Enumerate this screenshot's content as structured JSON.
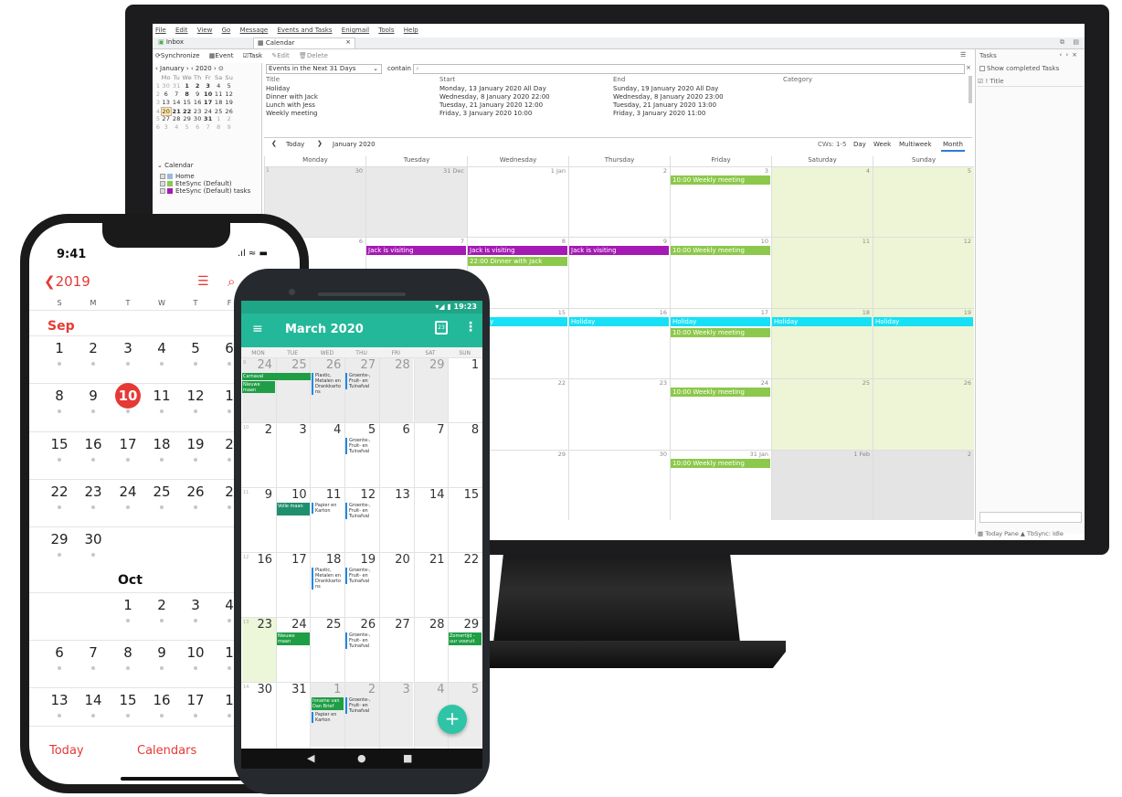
{
  "desktop": {
    "menu": [
      "File",
      "Edit",
      "View",
      "Go",
      "Message",
      "Events and Tasks",
      "Enigmail",
      "Tools",
      "Help"
    ],
    "tabs": {
      "inbox": "Inbox",
      "calendar": "Calendar",
      "close": "×"
    },
    "toolbar": {
      "synchronize": "Synchronize",
      "event": "Event",
      "task": "Task",
      "edit": "Edit",
      "delete": "Delete"
    },
    "minimonth": {
      "month": "January",
      "year": "2020",
      "weekdays": [
        "Mo",
        "Tu",
        "We",
        "Th",
        "Fr",
        "Sa",
        "Su"
      ],
      "weeks": [
        [
          "1",
          "30",
          "31",
          "1",
          "2",
          "3",
          "4",
          "5"
        ],
        [
          "2",
          "6",
          "7",
          "8",
          "9",
          "10",
          "11",
          "12"
        ],
        [
          "3",
          "13",
          "14",
          "15",
          "16",
          "17",
          "18",
          "19"
        ],
        [
          "4",
          "20",
          "21",
          "22",
          "23",
          "24",
          "25",
          "26"
        ],
        [
          "5",
          "27",
          "28",
          "29",
          "30",
          "31",
          "1",
          "2"
        ],
        [
          "6",
          "3",
          "4",
          "5",
          "6",
          "7",
          "8",
          "9"
        ]
      ]
    },
    "calendar_list": {
      "title": "Calendar",
      "items": [
        "Home",
        "EteSync (Default)",
        "EteSync (Default) tasks"
      ]
    },
    "filter": {
      "range": "Events in the Next 31 Days",
      "contain": "contain"
    },
    "event_list": {
      "headers": {
        "title": "Title",
        "start": "Start",
        "end": "End",
        "category": "Category"
      },
      "rows": [
        {
          "title": "Holiday",
          "start": "Monday, 13 January 2020 All Day",
          "end": "Sunday, 19 January 2020 All Day"
        },
        {
          "title": "Dinner with Jack",
          "start": "Wednesday, 8 January 2020 22:00",
          "end": "Wednesday, 8 January 2020 23:00"
        },
        {
          "title": "Lunch with Jess",
          "start": "Tuesday, 21 January 2020 12:00",
          "end": "Tuesday, 21 January 2020 13:00"
        },
        {
          "title": "Weekly meeting",
          "start": "Friday, 3 January 2020 10:00",
          "end": "Friday, 3 January 2020 11:00"
        }
      ]
    },
    "nav": {
      "today": "Today",
      "period": "January 2020",
      "cws": "CWs: 1-5",
      "views": [
        "Day",
        "Week",
        "Multiweek",
        "Month"
      ]
    },
    "weekdays": [
      "Monday",
      "Tuesday",
      "Wednesday",
      "Thursday",
      "Friday",
      "Saturday",
      "Sunday"
    ],
    "grid": {
      "row1": {
        "wk": "1",
        "days": [
          "30",
          "31 Dec",
          "1 Jan",
          "2",
          "3",
          "4",
          "5"
        ]
      },
      "row2": {
        "wk": "",
        "days": [
          "6",
          "7",
          "8",
          "9",
          "10",
          "11",
          "12"
        ]
      },
      "row3": {
        "days": [
          "15",
          "16",
          "17",
          "18",
          "19"
        ]
      },
      "row4": {
        "days": [
          "22",
          "23",
          "24",
          "25",
          "26"
        ]
      },
      "row5": {
        "days": [
          "29",
          "30",
          "31 Jan",
          "1 Feb",
          "2"
        ]
      }
    },
    "events": {
      "weekly": "10:00 Weekly meeting",
      "jack": "Jack is visiting",
      "dinner": "22:00 Dinner with Jack",
      "holiday": "Holiday"
    },
    "tasks": {
      "title": "Tasks",
      "show_completed": "Show completed Tasks",
      "col_title": "Title"
    },
    "status": {
      "today_pane": "Today Pane ▲",
      "sync": "TbSync: Idle"
    }
  },
  "iphone": {
    "time": "9:41",
    "back": "2019",
    "weekdays": [
      "S",
      "M",
      "T",
      "W",
      "T",
      "F"
    ],
    "month1": "Sep",
    "month2": "Oct",
    "rows": [
      [
        "1",
        "2",
        "3",
        "4",
        "5",
        "6"
      ],
      [
        "8",
        "9",
        "10",
        "11",
        "12",
        "1"
      ],
      [
        "15",
        "16",
        "17",
        "18",
        "19",
        "2"
      ],
      [
        "22",
        "23",
        "24",
        "25",
        "26",
        "2"
      ],
      [
        "29",
        "30"
      ],
      [
        "",
        "",
        "1",
        "2",
        "3",
        "4"
      ],
      [
        "6",
        "7",
        "8",
        "9",
        "10",
        "1"
      ],
      [
        "13",
        "14",
        "15",
        "16",
        "17",
        "1"
      ]
    ],
    "today_label": "Today",
    "calendars_label": "Calendars"
  },
  "android": {
    "time": "19:23",
    "title": "March 2020",
    "date_icon": "23",
    "weekdays": [
      "MON",
      "TUE",
      "WED",
      "THU",
      "FRI",
      "SAT",
      "SUN"
    ],
    "weeks": [
      {
        "wk": "9",
        "days": [
          "24",
          "25",
          "26",
          "27",
          "28",
          "29",
          "1"
        ]
      },
      {
        "wk": "10",
        "days": [
          "2",
          "3",
          "4",
          "5",
          "6",
          "7",
          "8"
        ]
      },
      {
        "wk": "11",
        "days": [
          "9",
          "10",
          "11",
          "12",
          "13",
          "14",
          "15"
        ]
      },
      {
        "wk": "12",
        "days": [
          "16",
          "17",
          "18",
          "19",
          "20",
          "21",
          "22"
        ]
      },
      {
        "wk": "13",
        "days": [
          "23",
          "24",
          "25",
          "26",
          "27",
          "28",
          "29"
        ]
      },
      {
        "wk": "14",
        "days": [
          "30",
          "31",
          "1",
          "2",
          "3",
          "4",
          "5"
        ]
      }
    ],
    "events": {
      "carnaval": "Carnaval",
      "nieuwe_maan": "Nieuwe maan",
      "plastic": "Plastic, Metalen en Drankkarto ns",
      "groente": "Groente-, Fruit- en Tuinafval",
      "volle_maan": "Volle maan",
      "papier": "Papier en Karton",
      "zomertijd": "Zomertijd - uur vooruit",
      "inname": "Inname van Dan Brief"
    },
    "fab": "+"
  }
}
